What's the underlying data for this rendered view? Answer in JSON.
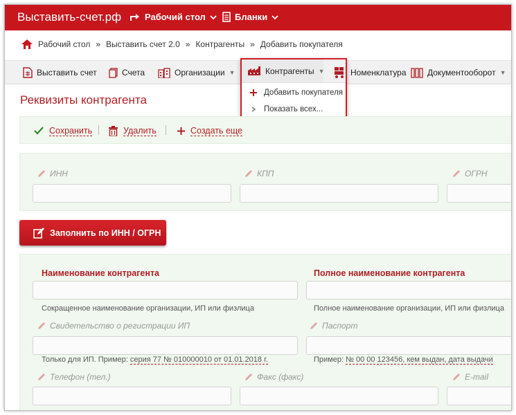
{
  "brand": "Выставить-счет.рф",
  "topnav": {
    "desktop": "Рабочий стол",
    "blanks": "Бланки"
  },
  "breadcrumb": [
    "Рабочий стол",
    "Выставить счет 2.0",
    "Контрагенты",
    "Добавить покупателя"
  ],
  "menu": {
    "invoice": "Выставить счет",
    "bills": "Счета",
    "orgs": "Организации",
    "contractors": "Контрагенты",
    "nomenclature": "Номенклатура",
    "docflow": "Документооборот"
  },
  "dropdown": {
    "add_buyer": "Добавить покупателя",
    "show_all": "Показать всех..."
  },
  "page_title": "Реквизиты контрагента",
  "actions": {
    "save": "Сохранить",
    "delete": "Удалить",
    "create_more": "Создать еще"
  },
  "fields": {
    "inn": "ИНН",
    "kpp": "КПП",
    "ogrn": "ОГРН",
    "fill_button": "Заполнить по ИНН / ОГРН",
    "name_label": "Наименование контрагента",
    "name_hint": "Сокращенное наименование организации, ИП или физлица",
    "fullname_label": "Полное наименование контрагента",
    "fullname_hint": "Полное наименование организации, ИП или физлица",
    "certificate_label": "Свидетельство о регистрации ИП",
    "certificate_hint_prefix": "Только для ИП. Пример:",
    "certificate_hint_example": "серия 77 № 010000010 от 01.01.2018 г.",
    "passport_label": "Паспорт",
    "passport_hint_prefix": "Пример:",
    "passport_hint_example": "№ 00 00 123456, кем выдан, дата выдачи",
    "phone_label": "Телефон (тел.)",
    "fax_label": "Факс (факс)",
    "email_label": "E-mail"
  },
  "colors": {
    "brand_red": "#c8161d",
    "title_red": "#b01e24",
    "panel_green": "#f1f8ef"
  }
}
